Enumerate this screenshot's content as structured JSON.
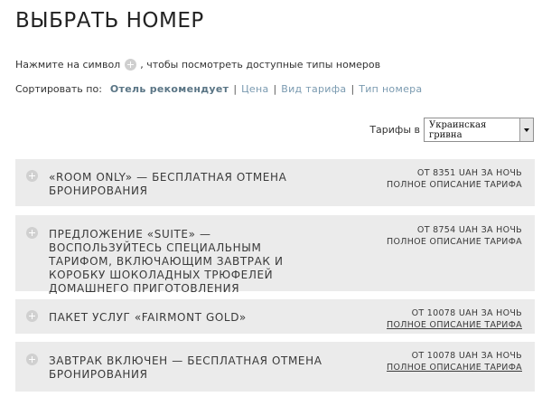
{
  "page": {
    "title": "ВЫБРАТЬ НОМЕР",
    "hint_before": "Нажмите на символ",
    "hint_after": ", чтобы посмотреть доступные типы номеров"
  },
  "sort": {
    "label": "Сортировать по:",
    "options": [
      "Отель рекомендует",
      "Цена",
      "Вид тарифа",
      "Тип номера"
    ],
    "active_index": 0
  },
  "currency": {
    "label": "Тарифы в",
    "selected": "Украинская гривна"
  },
  "rates": [
    {
      "name": "«ROOM ONLY» — БЕСПЛАТНАЯ ОТМЕНА БРОНИРОВАНИЯ",
      "price": "ОТ 8351 UAH ЗА НОЧЬ",
      "desc": "ПОЛНОЕ ОПИСАНИЕ ТАРИФА"
    },
    {
      "name": "ПРЕДЛОЖЕНИЕ «SUITE» — ВОСПОЛЬЗУЙТЕСЬ СПЕЦИАЛЬНЫМ ТАРИФОМ, ВКЛЮЧАЮЩИМ ЗАВТРАК И КОРОБКУ ШОКОЛАДНЫХ ТРЮФЕЛЕЙ ДОМАШНЕГО ПРИГОТОВЛЕНИЯ",
      "price": "ОТ 8754 UAH ЗА НОЧЬ",
      "desc": "ПОЛНОЕ ОПИСАНИЕ ТАРИФА"
    },
    {
      "name": "ПАКЕТ УСЛУГ «FAIRMONT GOLD»",
      "price": "ОТ 10078 UAH ЗА НОЧЬ",
      "desc": "ПОЛНОЕ ОПИСАНИЕ ТАРИФА"
    },
    {
      "name": "ЗАВТРАК ВКЛЮЧЕН — БЕСПЛАТНАЯ ОТМЕНА БРОНИРОВАНИЯ",
      "price": "ОТ 10078 UAH ЗА НОЧЬ",
      "desc": "ПОЛНОЕ ОПИСАНИЕ ТАРИФА"
    }
  ],
  "icons": {
    "expand": "plus-circle-icon",
    "dropdown": "chevron-down-icon"
  },
  "colors": {
    "rate_bg": "#ebebeb",
    "sort_link": "#7a9ab0",
    "sort_active": "#5a7585"
  }
}
